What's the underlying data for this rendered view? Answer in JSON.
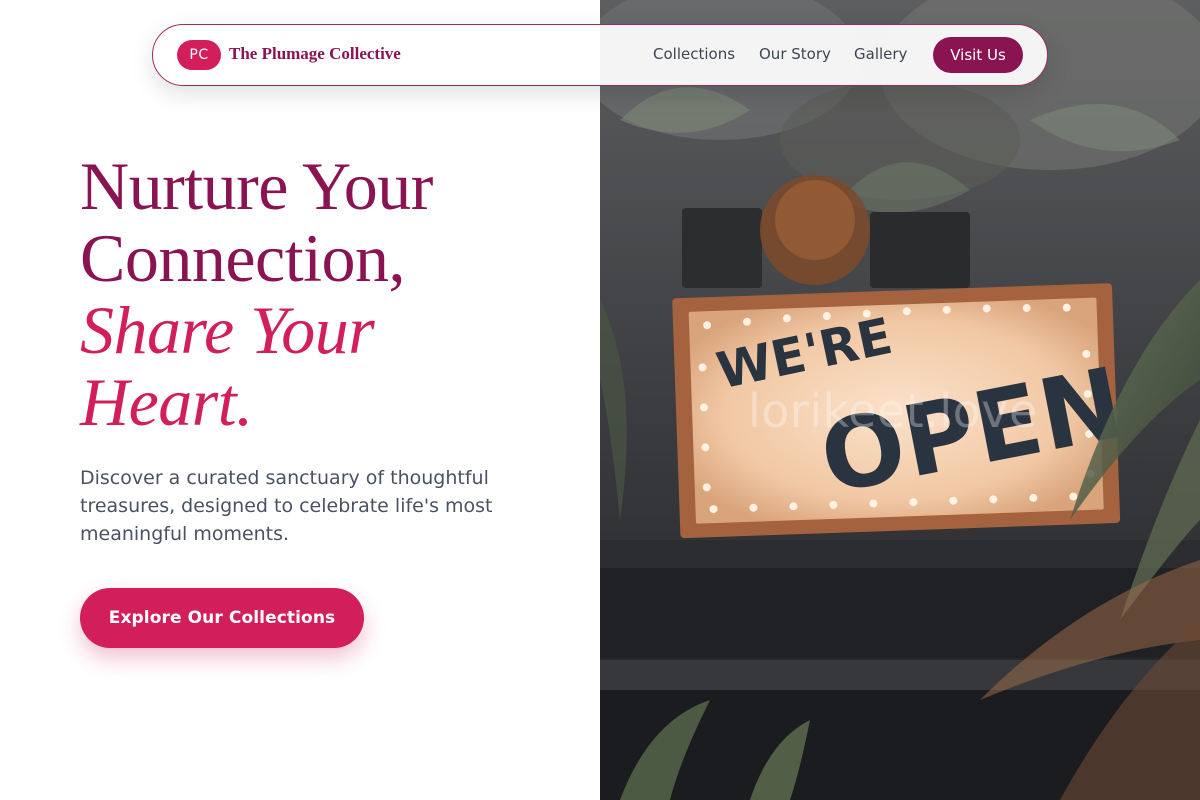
{
  "brand": {
    "badge": "PC",
    "name": "The Plumage Collective"
  },
  "nav": {
    "links": [
      {
        "label": "Collections"
      },
      {
        "label": "Our Story"
      },
      {
        "label": "Gallery"
      }
    ],
    "cta_label": "Visit Us"
  },
  "hero": {
    "headline_plain": [
      "Nurture Your",
      "Connection,"
    ],
    "headline_accent": [
      "Share Your",
      "Heart."
    ],
    "subtext_lines": [
      "Discover a curated sanctuary of thoughtful",
      "treasures, designed to celebrate life's most",
      "meaningful moments."
    ],
    "cta_label": "Explore Our Collections"
  },
  "photo": {
    "sign_text_top": "WE'RE",
    "sign_text_bottom": "OPEN",
    "watermark": "lorikeet.love"
  },
  "colors": {
    "primary": "#d21f5c",
    "deep": "#8a1352",
    "text_muted": "#4a5262"
  }
}
